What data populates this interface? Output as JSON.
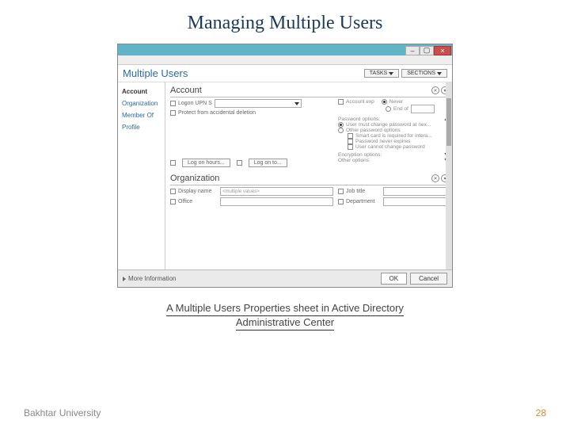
{
  "slide": {
    "title": "Managing Multiple Users",
    "caption_line1": "A Multiple Users Properties sheet in Active Directory",
    "caption_line2": "Administrative Center",
    "footer_left": "Bakhtar University",
    "page_number": "28"
  },
  "window": {
    "title": "Multiple Users",
    "min_glyph": "–",
    "max_glyph": "▢",
    "close_glyph": "×",
    "header_buttons": {
      "tasks": "TASKS",
      "sections": "SECTIONS"
    },
    "sidebar": {
      "items": [
        "Account",
        "Organization",
        "Member Of",
        "Profile"
      ],
      "selected": 0
    },
    "sections": {
      "account": {
        "title": "Account",
        "logon_upn_label": "Logon UPN S",
        "protect_label": "Protect from accidental deletion",
        "account_exp_label": "Account exp",
        "never_label": "Never",
        "end_of_label": "End of",
        "pwd_options_label": "Password options:",
        "must_change_label": "User must change password at nex...",
        "other_pwd_label": "Other password options",
        "smartcard_label": "Smart card is required for intera...",
        "pwd_never_label": "Password never expires",
        "cannot_change_label": "User cannot change password",
        "encryption_label": "Encryption options:",
        "other_options_label": "Other options:",
        "logon_hours_btn": "Log on hours...",
        "logon_to_btn": "Log on to..."
      },
      "organization": {
        "title": "Organization",
        "display_name_label": "Display name",
        "display_name_value": "<multiple values>",
        "office_label": "Office",
        "job_title_label": "Job title",
        "department_label": "Department"
      }
    },
    "footer": {
      "more_info": "More Information",
      "ok": "OK",
      "cancel": "Cancel"
    },
    "icons": {
      "expand": "▼",
      "collapse": "▲",
      "x_circle": "✕",
      "down_circle": "▾"
    }
  }
}
